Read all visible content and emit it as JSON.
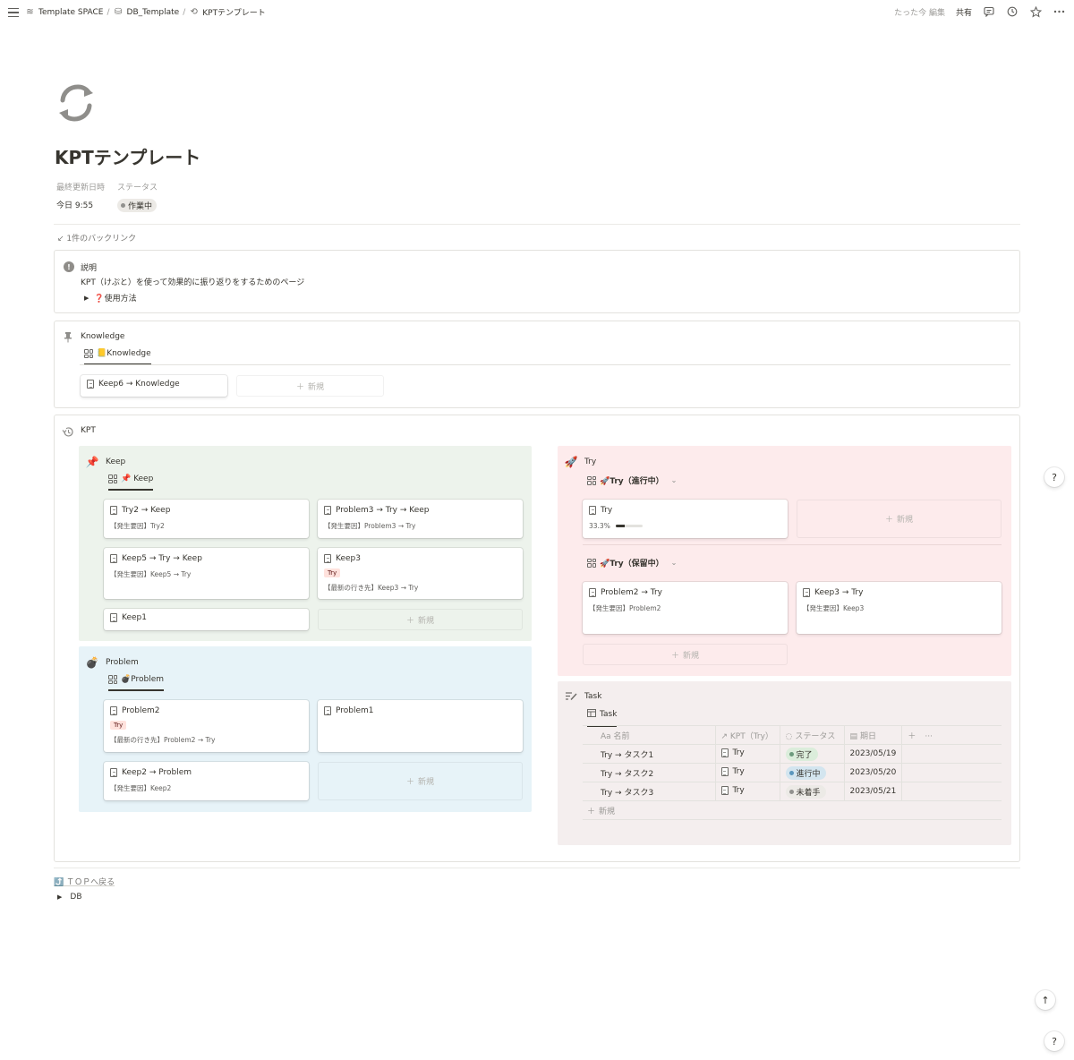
{
  "topbar": {
    "breadcrumbs": [
      {
        "icon": "stack-icon",
        "label": "Template SPACE"
      },
      {
        "icon": "database-icon",
        "label": "DB_Template"
      },
      {
        "icon": "refresh-icon",
        "label": "KPTテンプレート"
      }
    ],
    "edited": "たった今 編集",
    "share": "共有"
  },
  "page": {
    "icon": "refresh-arrows-icon",
    "title": "KPTテンプレート",
    "props": [
      {
        "label": "最終更新日時",
        "value": "今日 9:55"
      },
      {
        "label": "ステータス",
        "value": "作業中"
      }
    ],
    "backlinks": "↙ 1件のバックリンク"
  },
  "callout": {
    "title": "説明",
    "text": "KPT（けぷと）を使って効果的に振り返りをするためのページ",
    "toggle": "❓使用方法"
  },
  "knowledge": {
    "heading": "Knowledge",
    "tab": "📒Knowledge",
    "card": "Keep6 → Knowledge",
    "new": "新規"
  },
  "kpt": {
    "heading": "KPT",
    "keep": {
      "title": "Keep",
      "tab": "📌 Keep",
      "cards": [
        {
          "title": "Try2 → Keep",
          "desc": "【発生要因】Try2"
        },
        {
          "title": "Problem3 → Try → Keep",
          "desc": "【発生要因】Problem3 → Try"
        },
        {
          "title": "Keep5 → Try → Keep",
          "desc": "【発生要因】Keep5 → Try"
        },
        {
          "title": "Keep3",
          "tag": "Try",
          "desc": "【最新の行き先】Keep3 → Try"
        },
        {
          "title": "Keep1"
        }
      ],
      "new": "新規"
    },
    "problem": {
      "title": "Problem",
      "tab": "💣Problem",
      "cards": [
        {
          "title": "Problem2",
          "tag": "Try",
          "desc": "【最新の行き先】Problem2 → Try"
        },
        {
          "title": "Problem1"
        },
        {
          "title": "Keep2 → Problem",
          "desc": "【発生要因】Keep2"
        }
      ],
      "new": "新規"
    },
    "try": {
      "title": "Try",
      "tab1": "🚀Try（進行中）",
      "tab2": "🚀Try（保留中）",
      "active_card": {
        "title": "Try",
        "progress_label": "33.3%",
        "progress": 0.333
      },
      "held_cards": [
        {
          "title": "Problem2 → Try",
          "desc": "【発生要因】Problem2"
        },
        {
          "title": "Keep3 → Try",
          "desc": "【発生要因】Keep3"
        }
      ],
      "new": "新規"
    },
    "task": {
      "title": "Task",
      "tab": "Task",
      "columns": [
        "Aa 名前",
        "↗ KPT（Try）",
        "ステータス",
        "期日"
      ],
      "rows": [
        {
          "name": "Try → タスク1",
          "kpt": "Try",
          "status": "完了",
          "status_bg": "#dbeddb",
          "status_dot": "#6c9b7d",
          "date": "2023/05/19"
        },
        {
          "name": "Try → タスク2",
          "kpt": "Try",
          "status": "進行中",
          "status_bg": "#d3e5ef",
          "status_dot": "#5b97bd",
          "date": "2023/05/20"
        },
        {
          "name": "Try → タスク3",
          "kpt": "Try",
          "status": "未着手",
          "status_bg": "#eceae6",
          "status_dot": "#91918e",
          "date": "2023/05/21"
        }
      ],
      "new": "新規"
    }
  },
  "footer": {
    "back": "⤴️ ＴＯＰへ戻る",
    "db": "DB"
  },
  "colors": {
    "keep_bg": "#edf3ec",
    "problem_bg": "#e7f3f8",
    "try_bg": "#fdebec",
    "task_bg": "#f4eeee"
  }
}
